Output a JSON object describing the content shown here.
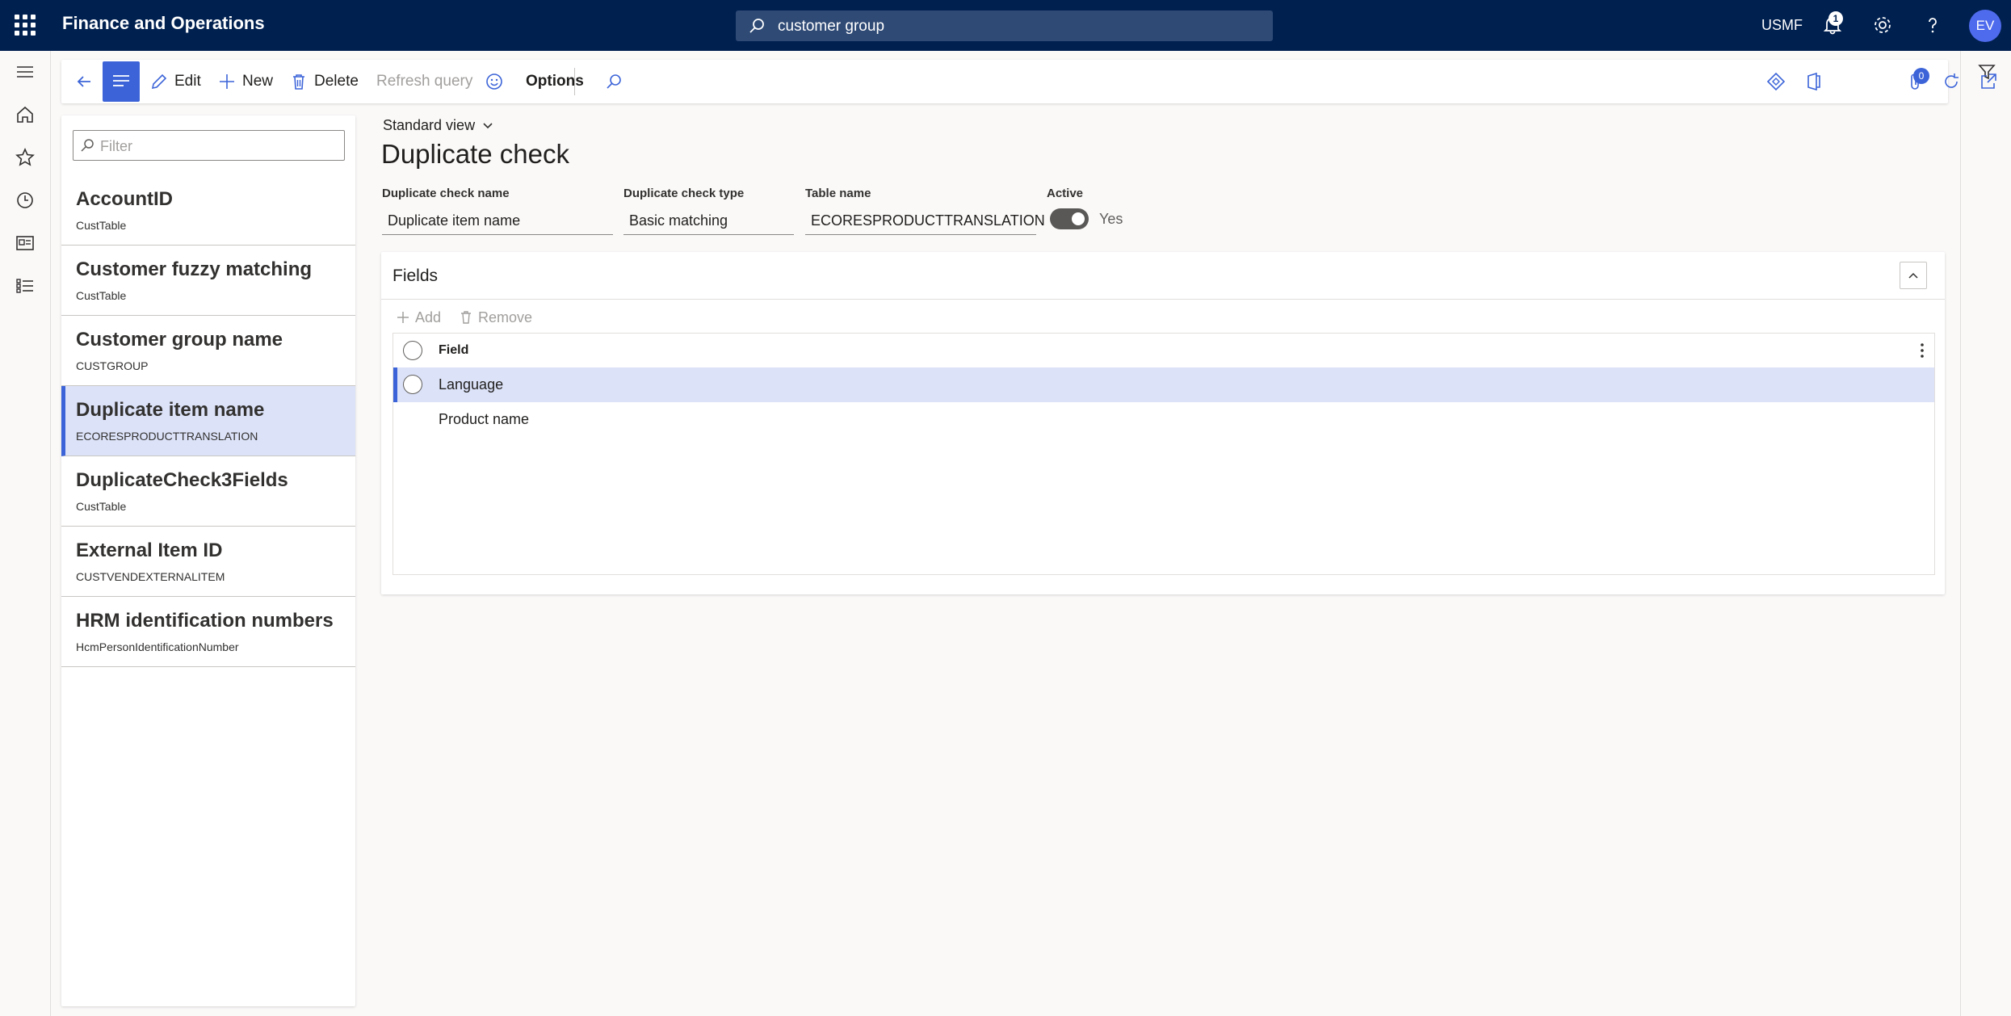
{
  "topbar": {
    "app_title": "Finance and Operations",
    "search_value": "customer group",
    "company": "USMF",
    "notification_count": "1",
    "avatar_initials": "EV"
  },
  "actions": {
    "edit": "Edit",
    "new": "New",
    "delete": "Delete",
    "refresh_query": "Refresh query",
    "options": "Options",
    "attachments_count": "0"
  },
  "list": {
    "filter_placeholder": "Filter",
    "items": [
      {
        "title": "AccountID",
        "subtitle": "CustTable"
      },
      {
        "title": "Customer fuzzy matching",
        "subtitle": "CustTable"
      },
      {
        "title": "Customer group name",
        "subtitle": "CUSTGROUP"
      },
      {
        "title": "Duplicate item name",
        "subtitle": "ECORESPRODUCTTRANSLATION"
      },
      {
        "title": "DuplicateCheck3Fields",
        "subtitle": "CustTable"
      },
      {
        "title": "External Item ID",
        "subtitle": "CUSTVENDEXTERNALITEM"
      },
      {
        "title": "HRM identification numbers",
        "subtitle": "HcmPersonIdentificationNumber"
      }
    ],
    "selected_index": 3
  },
  "detail": {
    "view": "Standard view",
    "title": "Duplicate check",
    "fields": {
      "name_label": "Duplicate check name",
      "name_value": "Duplicate item name",
      "type_label": "Duplicate check type",
      "type_value": "Basic matching",
      "table_label": "Table name",
      "table_value": "ECORESPRODUCTTRANSLATION",
      "active_label": "Active",
      "active_value": "Yes"
    }
  },
  "fields_section": {
    "title": "Fields",
    "add": "Add",
    "remove": "Remove",
    "column_header": "Field",
    "rows": [
      "Language",
      "Product name"
    ],
    "selected_row": 0
  },
  "colors": {
    "topbar": "#002050",
    "accent": "#3c64d8",
    "selection": "#dce2f8"
  }
}
